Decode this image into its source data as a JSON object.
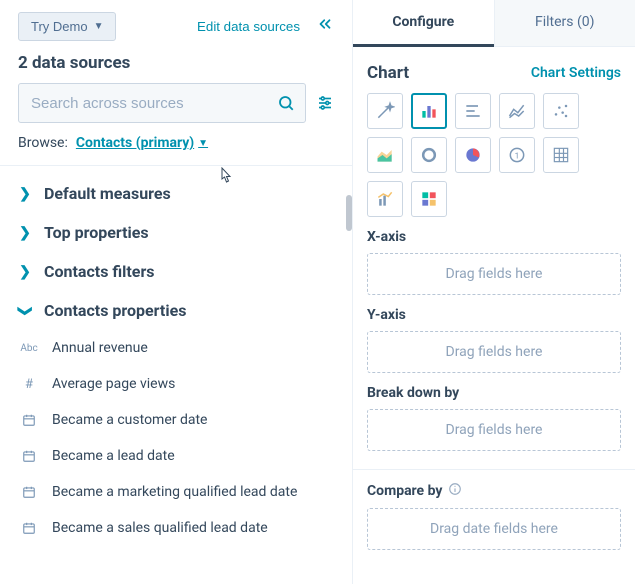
{
  "left": {
    "try_demo_label": "Try Demo",
    "edit_sources_label": "Edit data sources",
    "sources_count_label": "2 data sources",
    "search_placeholder": "Search across sources",
    "browse_label": "Browse:",
    "browse_value": "Contacts (primary)",
    "groups": [
      {
        "label": "Default measures",
        "expanded": false
      },
      {
        "label": "Top properties",
        "expanded": false
      },
      {
        "label": "Contacts filters",
        "expanded": false
      },
      {
        "label": "Contacts properties",
        "expanded": true
      }
    ],
    "properties": [
      {
        "type": "Abc",
        "label": "Annual revenue"
      },
      {
        "type": "#",
        "label": "Average page views"
      },
      {
        "type": "date",
        "label": "Became a customer date"
      },
      {
        "type": "date",
        "label": "Became a lead date"
      },
      {
        "type": "date",
        "label": "Became a marketing qualified lead date"
      },
      {
        "type": "date",
        "label": "Became a sales qualified lead date"
      }
    ]
  },
  "right": {
    "tabs": {
      "configure": "Configure",
      "filters": "Filters (0)"
    },
    "chart_section_title": "Chart",
    "chart_settings_label": "Chart Settings",
    "chart_types": [
      "magic",
      "bar-vertical",
      "bar-horizontal",
      "line",
      "scatter",
      "area",
      "donut",
      "pie",
      "kpi",
      "table",
      "combo",
      "summary"
    ],
    "selected_chart_type": "bar-vertical",
    "x_axis_label": "X-axis",
    "y_axis_label": "Y-axis",
    "breakdown_label": "Break down by",
    "compare_label": "Compare by",
    "drag_placeholder": "Drag fields here",
    "drag_date_placeholder": "Drag date fields here"
  }
}
